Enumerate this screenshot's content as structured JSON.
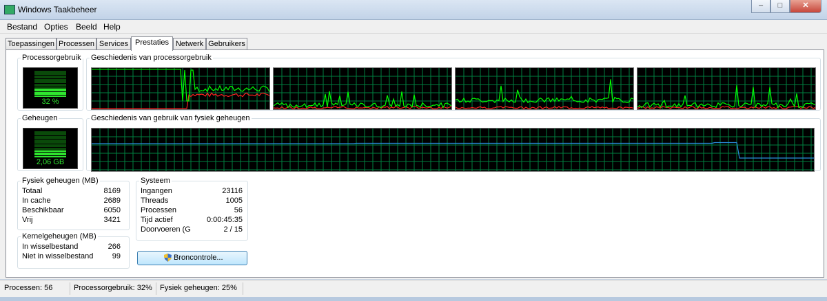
{
  "window": {
    "title": "Windows Taakbeheer",
    "minimize_glyph": "–",
    "maximize_glyph": "□",
    "close_glyph": "✕"
  },
  "menu": [
    "Bestand",
    "Opties",
    "Beeld",
    "Help"
  ],
  "tabs": [
    "Toepassingen",
    "Processen",
    "Services",
    "Prestaties",
    "Netwerk",
    "Gebruikers"
  ],
  "active_tab": "Prestaties",
  "cpu": {
    "group_label": "Processorgebruik",
    "value": "32 %",
    "percent": 32,
    "history_label": "Geschiedenis van processorgebruik",
    "core_count": 4
  },
  "memory": {
    "group_label": "Geheugen",
    "value": "2,06 GB",
    "percent": 25,
    "history_label": "Geschiedenis van gebruik van fysiek geheugen"
  },
  "physical_memory": {
    "title": "Fysiek geheugen (MB)",
    "rows": [
      {
        "label": "Totaal",
        "value": "8169"
      },
      {
        "label": "In cache",
        "value": "2689"
      },
      {
        "label": "Beschikbaar",
        "value": "6050"
      },
      {
        "label": "Vrij",
        "value": "3421"
      }
    ]
  },
  "kernel_memory": {
    "title": "Kernelgeheugen (MB)",
    "rows": [
      {
        "label": "In wisselbestand",
        "value": "266"
      },
      {
        "label": "Niet in wisselbestand",
        "value": "99"
      }
    ]
  },
  "system": {
    "title": "Systeem",
    "rows": [
      {
        "label": "Ingangen",
        "value": "23116"
      },
      {
        "label": "Threads",
        "value": "1005"
      },
      {
        "label": "Processen",
        "value": "56"
      },
      {
        "label": "Tijd actief",
        "value": "0:00:45:35"
      },
      {
        "label": "Doorvoeren (G",
        "value": "2 / 15"
      }
    ]
  },
  "resource_button": "Broncontrole...",
  "status": {
    "processes": "Processen: 56",
    "cpu": "Processorgebruik: 32%",
    "memory": "Fysiek geheugen: 25%"
  },
  "colors": {
    "graph_bg": "#000000",
    "grid": "#008040",
    "cpu_line": "#00ff00",
    "kernel_line": "#ff2020",
    "mem_line": "#2a8fe0",
    "meter_on": "#2fe52f",
    "meter_off": "#0a4a0a"
  }
}
